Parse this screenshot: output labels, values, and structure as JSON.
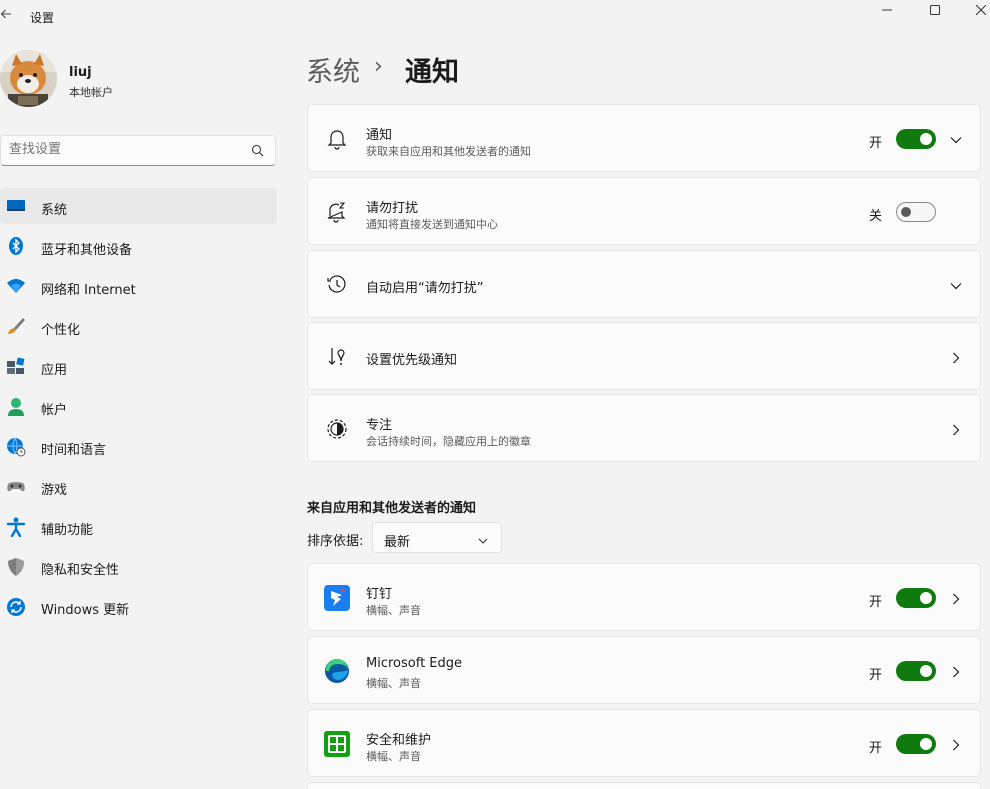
{
  "window": {
    "title": "设置",
    "back_icon": "back-arrow-icon",
    "controls": [
      "minimize-icon",
      "maximize-icon",
      "close-icon"
    ]
  },
  "user": {
    "name": "liuj",
    "account_type": "本地帐户"
  },
  "search": {
    "placeholder": "查找设置",
    "icon": "search-icon"
  },
  "sidebar": {
    "items": [
      {
        "label": "系统",
        "icon": "system-icon",
        "active": true
      },
      {
        "label": "蓝牙和其他设备",
        "icon": "bluetooth-icon"
      },
      {
        "label": "网络和 Internet",
        "icon": "wifi-icon"
      },
      {
        "label": "个性化",
        "icon": "brush-icon"
      },
      {
        "label": "应用",
        "icon": "apps-icon"
      },
      {
        "label": "帐户",
        "icon": "account-icon"
      },
      {
        "label": "时间和语言",
        "icon": "globe-clock-icon"
      },
      {
        "label": "游戏",
        "icon": "gamepad-icon"
      },
      {
        "label": "辅助功能",
        "icon": "accessibility-icon"
      },
      {
        "label": "隐私和安全性",
        "icon": "shield-icon"
      },
      {
        "label": "Windows 更新",
        "icon": "update-icon"
      }
    ]
  },
  "breadcrumb": {
    "section": "系统",
    "separator": "›",
    "current": "通知"
  },
  "settings": {
    "notifications": {
      "title": "通知",
      "desc": "获取来自应用和其他发送者的通知",
      "state": "开",
      "on": true,
      "icon": "bell-icon"
    },
    "dnd": {
      "title": "请勿打扰",
      "desc": "通知将直接发送到通知中心",
      "state": "关",
      "on": false,
      "icon": "bell-zz-icon"
    },
    "auto_dnd": {
      "title": "自动启用“请勿打扰”",
      "icon": "clock-icon"
    },
    "priority": {
      "title": "设置优先级通知",
      "icon": "priority-icon"
    },
    "focus": {
      "title": "专注",
      "desc": "会话持续时间，隐藏应用上的徽章",
      "icon": "focus-icon"
    }
  },
  "apps_section": {
    "title": "来自应用和其他发送者的通知",
    "sort_label": "排序依据:",
    "sort_value": "最新",
    "apps": [
      {
        "name": "钉钉",
        "desc": "横幅、声音",
        "state": "开",
        "on": true,
        "icon": "dingtalk-icon"
      },
      {
        "name": "Microsoft Edge",
        "desc": "横幅、声音",
        "state": "开",
        "on": true,
        "icon": "edge-icon"
      },
      {
        "name": "安全和维护",
        "desc": "横幅、声音",
        "state": "开",
        "on": true,
        "icon": "security-maintenance-icon"
      }
    ]
  },
  "colors": {
    "accent": "#0f7b0f",
    "background": "#f3f3f3",
    "card": "#fbfbfb"
  }
}
